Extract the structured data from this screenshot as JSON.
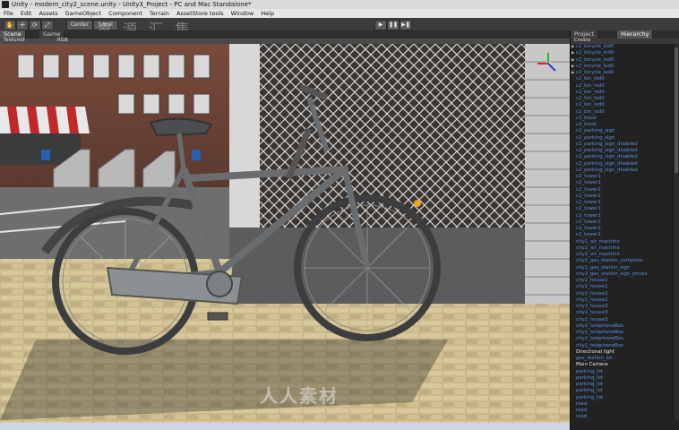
{
  "window": {
    "title": "Unity - modern_city2_scene.unity - Unity3_Project - PC and Mac Standalone*"
  },
  "menu": [
    "File",
    "Edit",
    "Assets",
    "GameObject",
    "Component",
    "Terrain",
    "AssetStore tools",
    "Window",
    "Help"
  ],
  "toolbar": {
    "tools": [
      "✋",
      "✛",
      "⟳",
      "⤢"
    ],
    "pivot": "Center",
    "space": "Local",
    "play": "▶",
    "pause": "❚❚",
    "step": "▶❚"
  },
  "tabs": {
    "scene": "Scene",
    "game": "Game",
    "project": "Project",
    "hierarchy": "Hierarchy"
  },
  "scenebar": {
    "mode": "Textured",
    "rgb": "RGB",
    "create": "Create"
  },
  "watermark": "资 源 汇 集",
  "watermark_bottom": "人人素材",
  "hierarchy": [
    {
      "label": "c2_bicycle_lod0",
      "arrow": true,
      "white": false
    },
    {
      "label": "c2_bicycle_lod0",
      "arrow": true,
      "white": false
    },
    {
      "label": "c2_bicycle_lod0",
      "arrow": true,
      "white": false
    },
    {
      "label": "c2_bicycle_lod0",
      "arrow": true,
      "white": false
    },
    {
      "label": "c2_bicycle_lod0",
      "arrow": true,
      "white": false
    },
    {
      "label": "c2_bin_lod0",
      "arrow": false,
      "white": false
    },
    {
      "label": "c2_bin_lod0",
      "arrow": false,
      "white": false
    },
    {
      "label": "c2_bin_lod0",
      "arrow": false,
      "white": false
    },
    {
      "label": "c2_bin_lod0",
      "arrow": false,
      "white": false
    },
    {
      "label": "c2_bin_lod0",
      "arrow": false,
      "white": false
    },
    {
      "label": "c2_bin_lod0",
      "arrow": false,
      "white": false
    },
    {
      "label": "c2_kiosk",
      "arrow": false,
      "white": false
    },
    {
      "label": "c2_kiosk",
      "arrow": false,
      "white": false
    },
    {
      "label": "c2_parking_sign",
      "arrow": false,
      "white": false
    },
    {
      "label": "c2_parking_sign",
      "arrow": false,
      "white": false
    },
    {
      "label": "c2_parking_sign_disabled",
      "arrow": false,
      "white": false
    },
    {
      "label": "c2_parking_sign_disabled",
      "arrow": false,
      "white": false
    },
    {
      "label": "c2_parking_sign_disabled",
      "arrow": false,
      "white": false
    },
    {
      "label": "c2_parking_sign_disabled",
      "arrow": false,
      "white": false
    },
    {
      "label": "c2_parking_sign_disabled",
      "arrow": false,
      "white": false
    },
    {
      "label": "c2_tower1",
      "arrow": false,
      "white": false
    },
    {
      "label": "c2_tower1",
      "arrow": false,
      "white": false
    },
    {
      "label": "c2_tower1",
      "arrow": false,
      "white": false
    },
    {
      "label": "c2_tower1",
      "arrow": false,
      "white": false
    },
    {
      "label": "c2_tower1",
      "arrow": false,
      "white": false
    },
    {
      "label": "c2_tower1",
      "arrow": false,
      "white": false
    },
    {
      "label": "c2_tower1",
      "arrow": false,
      "white": false
    },
    {
      "label": "c2_tower1",
      "arrow": false,
      "white": false
    },
    {
      "label": "c2_tower1",
      "arrow": false,
      "white": false
    },
    {
      "label": "c2_tower1",
      "arrow": false,
      "white": false
    },
    {
      "label": "city2_air_machine",
      "arrow": false,
      "white": false
    },
    {
      "label": "city2_air_machine",
      "arrow": false,
      "white": false
    },
    {
      "label": "city2_air_machine",
      "arrow": false,
      "white": false
    },
    {
      "label": "city2_gas_station_complete",
      "arrow": false,
      "white": false
    },
    {
      "label": "city2_gas_station_sign",
      "arrow": false,
      "white": false
    },
    {
      "label": "city2_gas_station_sign_prices",
      "arrow": false,
      "white": false
    },
    {
      "label": "city2_house1",
      "arrow": false,
      "white": false
    },
    {
      "label": "city2_house1",
      "arrow": false,
      "white": false
    },
    {
      "label": "city2_house2",
      "arrow": false,
      "white": false
    },
    {
      "label": "city2_house2",
      "arrow": false,
      "white": false
    },
    {
      "label": "city2_house3",
      "arrow": false,
      "white": false
    },
    {
      "label": "city2_house3",
      "arrow": false,
      "white": false
    },
    {
      "label": "city2_house3",
      "arrow": false,
      "white": false
    },
    {
      "label": "city2_telephoneBox",
      "arrow": false,
      "white": false
    },
    {
      "label": "city2_telephoneBox",
      "arrow": false,
      "white": false
    },
    {
      "label": "city2_telephoneBox",
      "arrow": false,
      "white": false
    },
    {
      "label": "city2_telephoneBox",
      "arrow": false,
      "white": false
    },
    {
      "label": "Directional light",
      "arrow": false,
      "white": true
    },
    {
      "label": "gas_station_lot",
      "arrow": false,
      "white": false
    },
    {
      "label": "Main Camera",
      "arrow": false,
      "white": true
    },
    {
      "label": "parking_lot",
      "arrow": false,
      "white": false
    },
    {
      "label": "parking_lot",
      "arrow": false,
      "white": false
    },
    {
      "label": "parking_lot",
      "arrow": false,
      "white": false
    },
    {
      "label": "parking_lot",
      "arrow": false,
      "white": false
    },
    {
      "label": "parking_lot",
      "arrow": false,
      "white": false
    },
    {
      "label": "road",
      "arrow": false,
      "white": false
    },
    {
      "label": "road",
      "arrow": false,
      "white": false
    },
    {
      "label": "road",
      "arrow": false,
      "white": false
    }
  ],
  "colors": {
    "hierarchy_link": "#5a8fe0",
    "panel_bg": "#222222"
  }
}
